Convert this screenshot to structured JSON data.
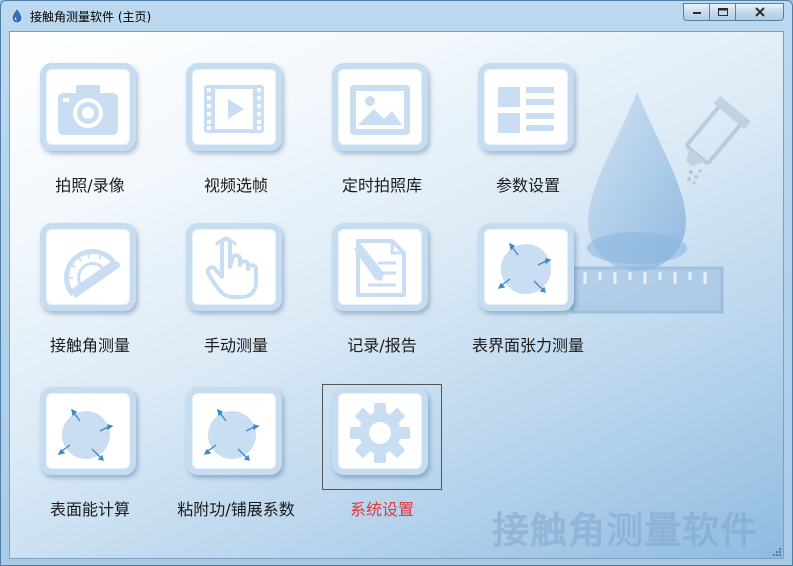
{
  "window": {
    "title": "接触角测量软件 (主页)",
    "controls": {
      "minimize": "minimize",
      "maximize": "maximize",
      "close": "close"
    }
  },
  "watermark": "接触角测量软件",
  "colors": {
    "icon_blue": "#c9def3",
    "selected_label": "#e0383e",
    "arrow_blue": "#3f87c9"
  },
  "tiles": [
    {
      "label": "拍照/录像",
      "icon": "camera-icon"
    },
    {
      "label": "视频选帧",
      "icon": "video-play-icon"
    },
    {
      "label": "定时拍照库",
      "icon": "image-gallery-icon"
    },
    {
      "label": "参数设置",
      "icon": "parameter-list-icon"
    },
    {
      "label": "接触角测量",
      "icon": "protractor-icon"
    },
    {
      "label": "手动测量",
      "icon": "hand-pointer-icon"
    },
    {
      "label": "记录/报告",
      "icon": "document-edit-icon"
    },
    {
      "label": "表界面张力测量",
      "icon": "surface-tension-icon"
    },
    {
      "label": "表面能计算",
      "icon": "surface-energy-icon"
    },
    {
      "label": "粘附功/铺展系数",
      "icon": "adhesion-work-icon"
    },
    {
      "label": "系统设置",
      "icon": "gear-icon",
      "selected": true
    }
  ]
}
